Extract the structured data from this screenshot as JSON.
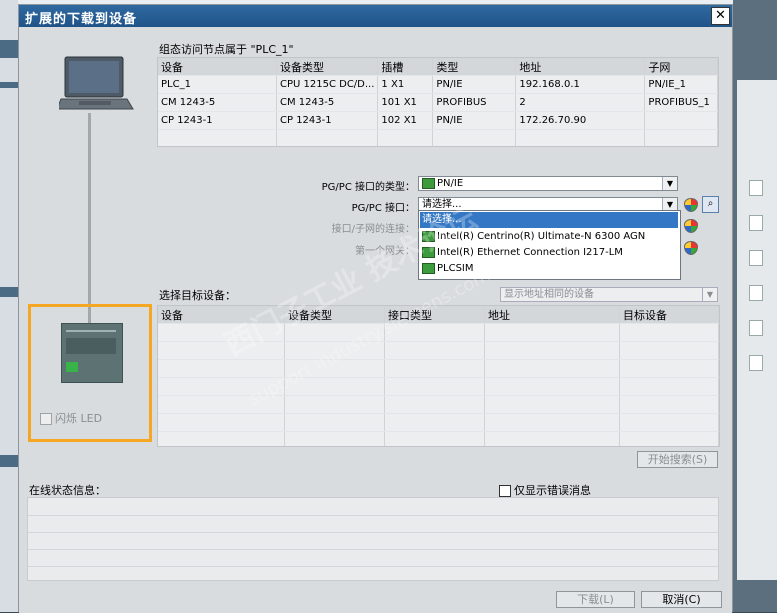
{
  "dialog": {
    "title": "扩展的下载到设备",
    "close_label": "✕"
  },
  "top_table": {
    "heading": "组态访问节点属于 \"PLC_1\"",
    "columns": [
      "设备",
      "设备类型",
      "插槽",
      "类型",
      "地址",
      "子网"
    ],
    "rows": [
      [
        "PLC_1",
        "CPU 1215C DC/D...",
        "1 X1",
        "PN/IE",
        "192.168.0.1",
        "PN/IE_1"
      ],
      [
        "CM 1243-5",
        "CM 1243-5",
        "101 X1",
        "PROFIBUS",
        "2",
        "PROFIBUS_1"
      ],
      [
        "CP 1243-1",
        "CP 1243-1",
        "102 X1",
        "PN/IE",
        "172.26.70.90",
        ""
      ]
    ]
  },
  "settings": {
    "interface_type_label": "PG/PC 接口的类型：",
    "interface_type_value": "PN/IE",
    "interface_label": "PG/PC 接口：",
    "interface_value": "请选择...",
    "subnet_conn_label": "接口/子网的连接：",
    "gateway_label": "第一个网关："
  },
  "dropdown": {
    "items": [
      "请选择...",
      "Intel(R) Centrino(R) Ultimate-N 6300 AGN",
      "Intel(R) Ethernet Connection I217-LM",
      "PLCSIM"
    ]
  },
  "target": {
    "heading": "选择目标设备：",
    "filter_value": "显示地址相同的设备",
    "columns": [
      "设备",
      "设备类型",
      "接口类型",
      "地址",
      "目标设备"
    ]
  },
  "device_panel": {
    "flash_label": "闪烁 LED"
  },
  "buttons": {
    "search": "开始搜索(S)",
    "download": "下载(L)",
    "cancel": "取消(C)"
  },
  "status": {
    "heading": "在线状态信息：",
    "errors_only": "仅显示错误消息"
  },
  "watermark": {
    "line1": "西门子工业 技术论坛",
    "line2": "support.industry.siemens.com"
  }
}
